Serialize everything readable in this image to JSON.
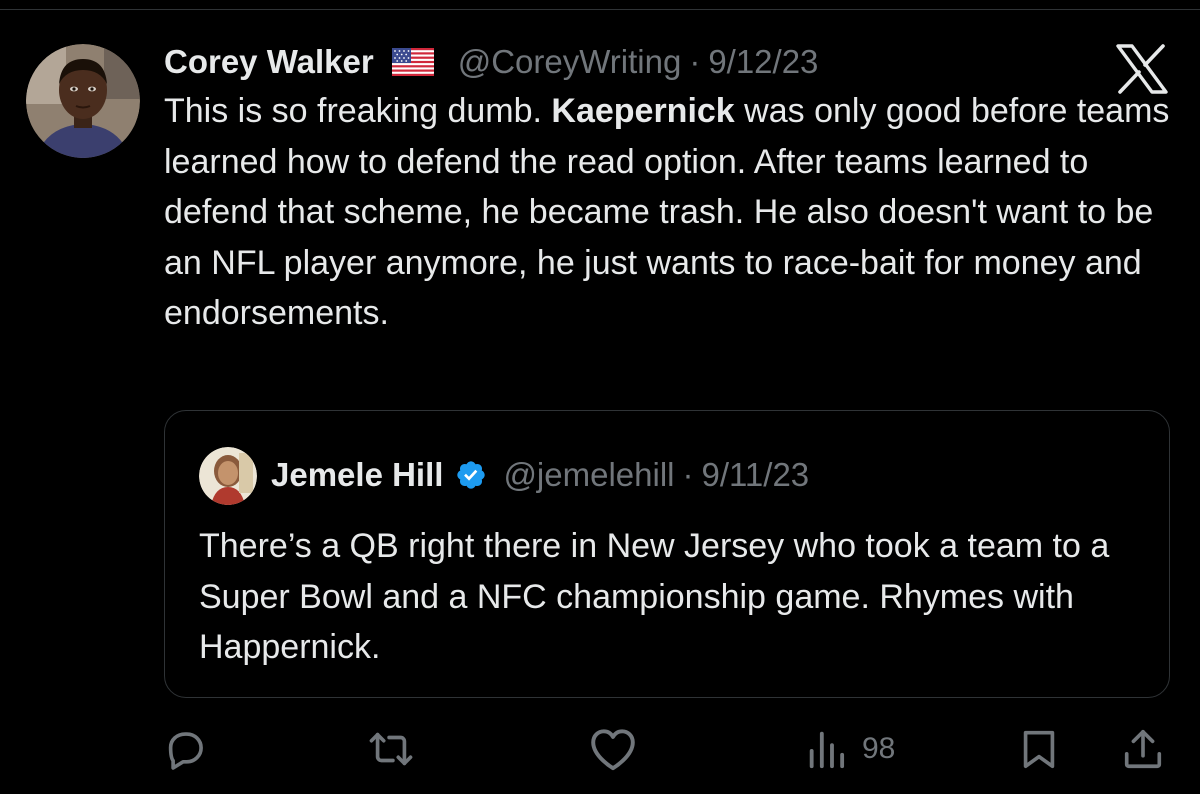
{
  "tweet": {
    "author_name": "Corey Walker",
    "flag": "🇺🇸",
    "handle": "@CoreyWriting",
    "separator": "·",
    "date": "9/12/23",
    "text_before": "This is so freaking dumb. ",
    "text_bold": "Kaepernick",
    "text_after": " was only good before teams learned how to defend the read option. After teams learned to defend that scheme, he became trash. He also doesn't want to be an NFL player anymore, he just wants to race-bait for money and endorsements."
  },
  "quoted_tweet": {
    "author_name": "Jemele Hill",
    "verified": true,
    "handle": "@jemelehill",
    "separator": "·",
    "date": "9/11/23",
    "text": "There’s a QB right there in New Jersey who took a team to a Super Bowl and a NFC championship game. Rhymes with Happernick."
  },
  "actions": {
    "reply_icon": "reply-icon",
    "retweet_icon": "retweet-icon",
    "like_icon": "heart-icon",
    "views_icon": "views-icon",
    "views_count": "98",
    "bookmark_icon": "bookmark-icon",
    "share_icon": "share-icon"
  },
  "brand": {
    "logo": "x-logo-icon"
  },
  "colors": {
    "background": "#000000",
    "text_primary": "#e7e9ea",
    "text_secondary": "#71767b",
    "border": "#2f3336",
    "verified_blue": "#1d9bf0"
  }
}
